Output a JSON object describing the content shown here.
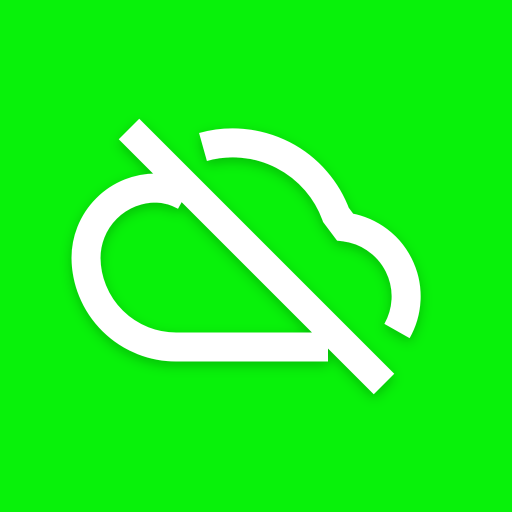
{
  "app_icon": {
    "icon": "cloud-off-icon",
    "background_color": "#08F20A",
    "glyph_color": "#FFFFFF"
  }
}
